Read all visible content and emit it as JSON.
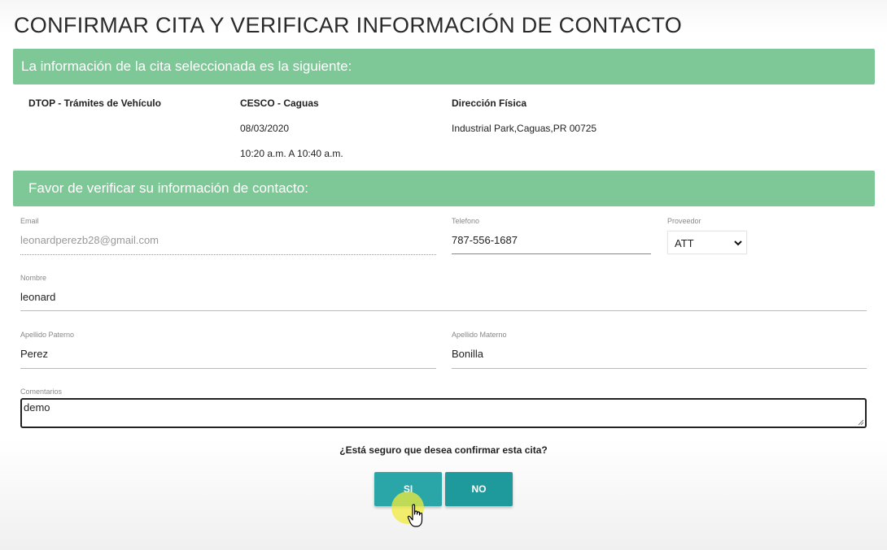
{
  "page": {
    "title": "CONFIRMAR CITA Y VERIFICAR INFORMACIÓN DE CONTACTO"
  },
  "appointment": {
    "header": "La información de la cita seleccionada es la siguiente:",
    "service": "DTOP - Trámites de Vehículo",
    "location": "CESCO - Caguas",
    "date": "08/03/2020",
    "time": "10:20 a.m. A 10:40 a.m.",
    "address_label": "Dirección Física",
    "address": "Industrial Park,Caguas,PR 00725"
  },
  "contact": {
    "header": "Favor de verificar su información de contacto:",
    "email_label": "Email",
    "email": "leonardperezb28@gmail.com",
    "phone_label": "Telefono",
    "phone": "787-556-1687",
    "provider_label": "Proveedor",
    "provider": "ATT",
    "name_label": "Nombre",
    "name": "leonard",
    "paternal_label": "Apellido Paterno",
    "paternal": "Perez",
    "maternal_label": "Apellido Materno",
    "maternal": "Bonilla",
    "comments_label": "Comentarios",
    "comments": "demo"
  },
  "confirm": {
    "question": "¿Está seguro que desea confirmar esta cita?",
    "yes_label": "SI",
    "no_label": "NO"
  },
  "icons": [
    "chevron-down-icon",
    "resize-handle-icon",
    "hand-pointer-icon"
  ]
}
